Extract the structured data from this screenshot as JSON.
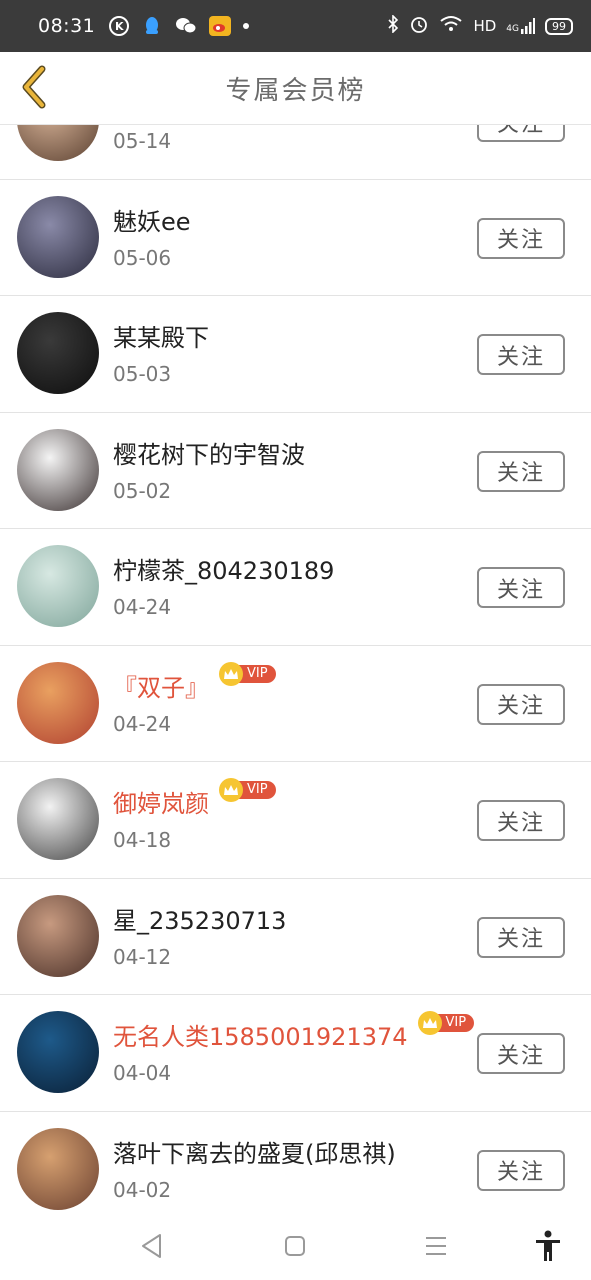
{
  "status_bar": {
    "time": "08:31",
    "network": "HD",
    "signal": "4G",
    "battery": "99"
  },
  "header": {
    "title": "专属会员榜"
  },
  "follow_label": "关注",
  "vip_label": "VIP",
  "members": [
    {
      "name": "",
      "date": "05-14",
      "vip": false,
      "avatar_colors": [
        "#d9b59a",
        "#5a4030"
      ]
    },
    {
      "name": "魅妖ee",
      "date": "05-06",
      "vip": false,
      "avatar_colors": [
        "#8a8aa8",
        "#2b2b3d"
      ]
    },
    {
      "name": "某某殿下",
      "date": "05-03",
      "vip": false,
      "avatar_colors": [
        "#3a3a3a",
        "#0d0d0d"
      ]
    },
    {
      "name": "樱花树下的宇智波",
      "date": "05-02",
      "vip": false,
      "avatar_colors": [
        "#f4f4f4",
        "#3a3030"
      ]
    },
    {
      "name": "柠檬茶_804230189",
      "date": "04-24",
      "vip": false,
      "avatar_colors": [
        "#d7e8e2",
        "#7fa59a"
      ]
    },
    {
      "name": "『双子』",
      "date": "04-24",
      "vip": true,
      "avatar_colors": [
        "#e9a060",
        "#b04030"
      ]
    },
    {
      "name": "御婷岚颜",
      "date": "04-18",
      "vip": true,
      "avatar_colors": [
        "#f2f2f2",
        "#444444"
      ]
    },
    {
      "name": "星_235230713",
      "date": "04-12",
      "vip": false,
      "avatar_colors": [
        "#c79a80",
        "#4a3028"
      ]
    },
    {
      "name": "无名人类1585001921374",
      "date": "04-04",
      "vip": true,
      "avatar_colors": [
        "#1e5a8a",
        "#0a1f35"
      ]
    },
    {
      "name": "落叶下离去的盛夏(邱思祺)",
      "date": "04-02",
      "vip": false,
      "avatar_colors": [
        "#d6a070",
        "#6a4030"
      ]
    }
  ],
  "colors": {
    "accent_back": "#e9b53a",
    "vip_name": "#e0543c",
    "vip_badge": "#e0543c",
    "crown": "#f6c531"
  }
}
